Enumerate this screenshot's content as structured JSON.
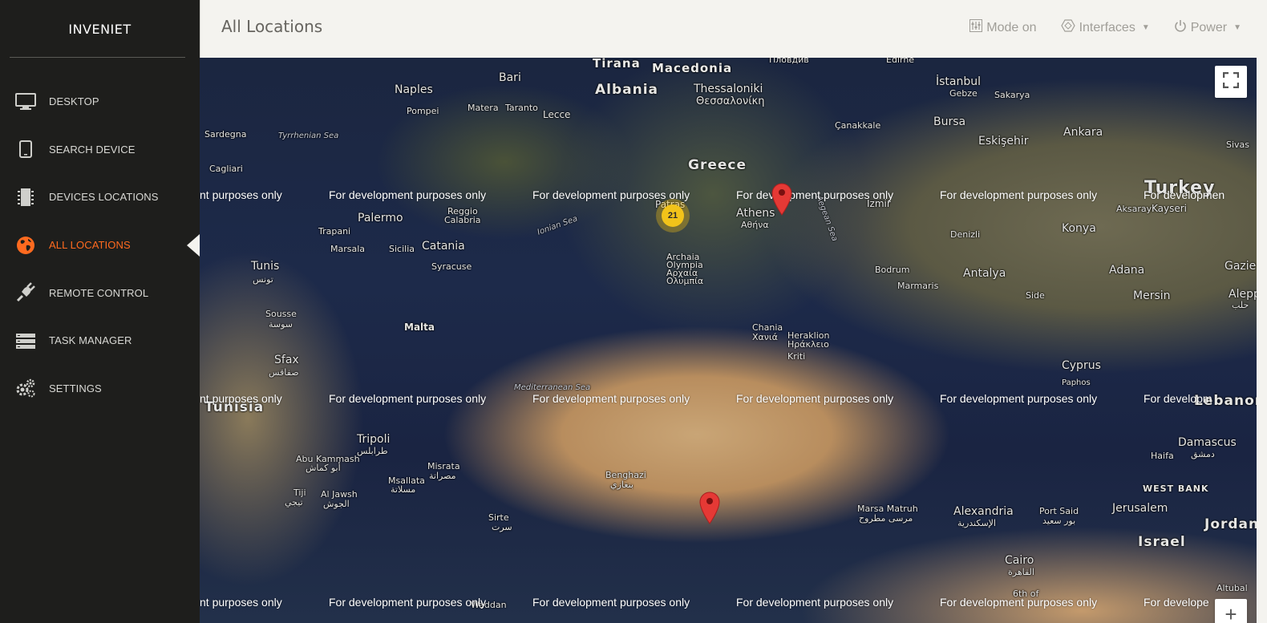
{
  "app": {
    "brand": "INVENIET"
  },
  "sidebar": {
    "items": [
      {
        "label": "DESKTOP",
        "icon": "monitor-icon",
        "active": false
      },
      {
        "label": "SEARCH DEVICE",
        "icon": "tablet-icon",
        "active": false
      },
      {
        "label": "DEVICES LOCATIONS",
        "icon": "chip-icon",
        "active": false
      },
      {
        "label": "ALL LOCATIONS",
        "icon": "globe-icon",
        "active": true
      },
      {
        "label": "REMOTE CONTROL",
        "icon": "plug-icon",
        "active": false
      },
      {
        "label": "TASK MANAGER",
        "icon": "server-icon",
        "active": false
      },
      {
        "label": "SETTINGS",
        "icon": "gears-icon",
        "active": false
      }
    ]
  },
  "header": {
    "title": "All Locations",
    "mode_label": "Mode on",
    "interfaces_label": "Interfaces",
    "power_label": "Power"
  },
  "map": {
    "watermark_text": "For development purposes only",
    "watermark_fragment_left": "nt purposes only",
    "watermark_fragment_right": "For developmen",
    "watermark_fragment_right_2": "For developm",
    "watermark_fragment_right_3": "For develope",
    "cluster_count": "21",
    "zoom_in_label": "+",
    "places": {
      "tirana": "Tirana",
      "macedonia": "Macedonia",
      "plovdiv": "Пловдив",
      "edirne": "Edirne",
      "naples": "Naples",
      "bari": "Bari",
      "albania": "Albania",
      "thessaloniki": "Thessaloniki",
      "thessaloniki_gr": "Θεσσαλονίκη",
      "istanbul": "İstanbul",
      "gebze": "Gebze",
      "sakarya": "Sakarya",
      "pompei": "Pompei",
      "matera": "Matera",
      "taranto": "Taranto",
      "lecce": "Lecce",
      "canakkale": "Çanakkale",
      "bursa": "Bursa",
      "ankara": "Ankara",
      "sardegna": "Sardegna",
      "tyrrhenian": "Tyrrhenian Sea",
      "eskisehir": "Eskişehir",
      "sivas": "Sivas",
      "greece": "Greece",
      "cagliari": "Cagliari",
      "turkey": "Turkey",
      "patras": "Patras",
      "athens": "Athens",
      "athens_gr": "Αθήνα",
      "izmir": "İzmir",
      "aksaray": "Aksaray",
      "kayseri": "Kayseri",
      "palermo": "Palermo",
      "reggio": "Reggio",
      "calabria": "Calabria",
      "ionian": "Ionian Sea",
      "aegean": "Aegean Sea",
      "trapani": "Trapani",
      "catania": "Catania",
      "denizli": "Denizli",
      "konya": "Konya",
      "marsala": "Marsala",
      "sicilia": "Sicilia",
      "syracuse": "Syracuse",
      "archaia": "Archaia",
      "olympia": "Olympia",
      "archaia_gr": "Αρχαία",
      "olympia_gr": "Ολυμπία",
      "tunis": "Tunis",
      "tunis_ar": "تونس",
      "bodrum": "Bodrum",
      "antalya": "Antalya",
      "adana": "Adana",
      "gazie": "Gazie",
      "marmaris": "Marmaris",
      "side": "Side",
      "mersin": "Mersin",
      "aleppo": "Aleppo",
      "aleppo_ar": "حلب",
      "sousse": "Sousse",
      "sousse_ar": "سوسة",
      "malta": "Malta",
      "chania": "Chania",
      "chania_gr": "Χανιά",
      "heraklion": "Heraklion",
      "heraklion_gr": "Ηράκλειο",
      "kriti": "Kriti",
      "sfax": "Sfax",
      "sfax_ar": "صفاقس",
      "cyprus": "Cyprus",
      "paphos": "Paphos",
      "tunisia": "Tunisia",
      "mediterranean": "Mediterranean Sea",
      "lebanon": "Lebanon",
      "tripoli": "Tripoli",
      "tripoli_ar": "طرابلس",
      "damascus": "Damascus",
      "damascus_ar": "دمشق",
      "abukammash": "Abu Kammash",
      "abukammash_ar": "أبو كماش",
      "misrata": "Misrata",
      "misrata_ar": "مصراتة",
      "haifa": "Haifa",
      "alexandria": "Alexandria",
      "alexandria_ar": "الإسكندرية",
      "benghazi": "Benghazi",
      "benghazi_ar": "بنغازي",
      "westbank": "WEST BANK",
      "jerusalem": "Jerusalem",
      "tiji": "Tiji",
      "tiji_ar": "تيجي",
      "aljawsh": "Al Jawsh",
      "aljawsh_ar": "الجوش",
      "msallata": "Msallata",
      "msallata_ar": "مسلاتة",
      "marsamatruh": "Marsa Matruh",
      "marsamatruh_ar": "مرسى مطروح",
      "portsaid": "Port Said",
      "portsaid_ar": "بور سعيد",
      "sirte": "Sirte",
      "sirte_ar": "سرت",
      "israel": "Israel",
      "jordan": "Jordan",
      "cairo": "Cairo",
      "cairo_ar": "القاهرة",
      "sixthof": "6th of",
      "altubai": "Altubal",
      "waddan": "Waddan"
    }
  }
}
